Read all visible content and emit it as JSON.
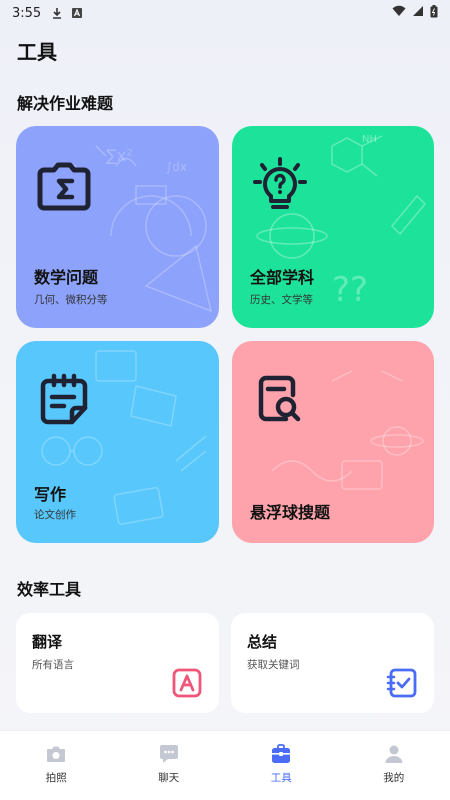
{
  "status_bar": {
    "time": "3:55",
    "icons": [
      "download-icon",
      "a-icon",
      "wifi-icon",
      "signal-icon",
      "battery-icon"
    ]
  },
  "page": {
    "title": "工具"
  },
  "sections": {
    "homework": {
      "title": "解决作业难题"
    },
    "efficiency": {
      "title": "效率工具"
    }
  },
  "cards": {
    "math": {
      "title": "数学问题",
      "subtitle": "几何、微积分等",
      "color": "#8da2fb",
      "icon": "sigma-camera-icon"
    },
    "all_subjects": {
      "title": "全部学科",
      "subtitle": "历史、文学等",
      "color": "#1de39a",
      "icon": "lightbulb-question-icon"
    },
    "writing": {
      "title": "写作",
      "subtitle": "论文创作",
      "color": "#57c7fc",
      "icon": "notepad-icon"
    },
    "floating_ball": {
      "title": "悬浮球搜题",
      "color": "#fea3ac",
      "icon": "document-search-icon"
    }
  },
  "tools": {
    "translate": {
      "title": "翻译",
      "subtitle": "所有语言",
      "icon": "translate-a-icon",
      "accent": "#f0557a"
    },
    "summary": {
      "title": "总结",
      "subtitle": "获取关键词",
      "icon": "checklist-icon",
      "accent": "#4a6cf7"
    }
  },
  "bottom_nav": {
    "items": [
      {
        "label": "拍照",
        "icon": "camera-icon"
      },
      {
        "label": "聊天",
        "icon": "chat-icon"
      },
      {
        "label": "工具",
        "icon": "toolbox-icon",
        "active": true
      },
      {
        "label": "我的",
        "icon": "person-icon"
      }
    ],
    "active_color": "#4a6cf7"
  }
}
